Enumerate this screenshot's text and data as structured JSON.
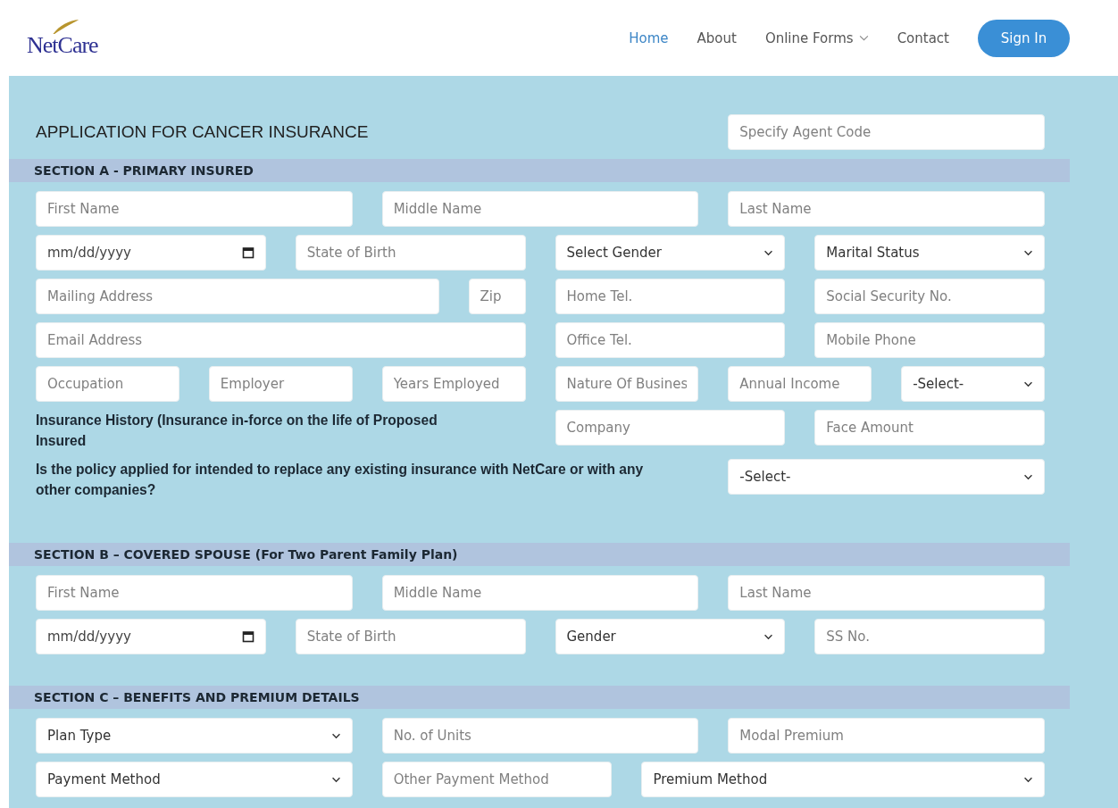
{
  "header": {
    "logo": "NetCare",
    "nav": [
      {
        "label": "Home",
        "selected": true,
        "has_menu": false
      },
      {
        "label": "About",
        "selected": false,
        "has_menu": false
      },
      {
        "label": "Online Forms",
        "selected": false,
        "has_menu": true
      },
      {
        "label": "Contact",
        "selected": false,
        "has_menu": false
      }
    ],
    "sign_in": "Sign In"
  },
  "form": {
    "title": "APPLICATION FOR CANCER INSURANCE",
    "agent_code": {
      "placeholder": "Specify Agent Code"
    },
    "sections": [
      {
        "title": "SECTION A - PRIMARY INSURED",
        "rows": [
          {
            "fields": [
              {
                "kind": "text",
                "placeholder": "First Name"
              },
              {
                "kind": "text",
                "placeholder": "Middle Name"
              },
              {
                "kind": "text",
                "placeholder": "Last Name"
              }
            ]
          },
          {
            "fields": [
              {
                "kind": "date",
                "placeholder": "mm/dd/yyyy"
              },
              {
                "kind": "text",
                "placeholder": "State of Birth"
              },
              {
                "kind": "select",
                "value": "Select Gender"
              },
              {
                "kind": "select",
                "value": "Marital Status"
              }
            ]
          },
          {
            "fields": [
              {
                "kind": "text",
                "placeholder": "Mailing Address"
              },
              {
                "kind": "text",
                "placeholder": "Zip"
              },
              {
                "kind": "text",
                "placeholder": "Home Tel."
              },
              {
                "kind": "text",
                "placeholder": "Social Security No."
              }
            ]
          },
          {
            "fields": [
              {
                "kind": "text",
                "placeholder": "Email Address"
              },
              {
                "kind": "text",
                "placeholder": "Office Tel."
              },
              {
                "kind": "text",
                "placeholder": "Mobile Phone"
              }
            ]
          },
          {
            "fields": [
              {
                "kind": "text",
                "placeholder": "Occupation"
              },
              {
                "kind": "text",
                "placeholder": "Employer"
              },
              {
                "kind": "text",
                "placeholder": "Years Employed"
              },
              {
                "kind": "text",
                "placeholder": "Nature Of Busines"
              },
              {
                "kind": "text",
                "placeholder": "Annual Income"
              },
              {
                "kind": "select",
                "value": "-Select-"
              }
            ]
          },
          {
            "fields": [
              {
                "kind": "label",
                "text": "Insurance History (Insurance in-force on the life of Proposed Insured"
              },
              {
                "kind": "text",
                "placeholder": "Company"
              },
              {
                "kind": "text",
                "placeholder": "Face Amount"
              }
            ]
          },
          {
            "fields": [
              {
                "kind": "label",
                "text": "Is the policy applied for intended to replace any existing insurance with NetCare or with any other companies?"
              },
              {
                "kind": "select",
                "value": "-Select-"
              }
            ]
          }
        ]
      },
      {
        "title": "SECTION B – COVERED SPOUSE (For Two Parent Family Plan)",
        "rows": [
          {
            "fields": [
              {
                "kind": "text",
                "placeholder": "First Name"
              },
              {
                "kind": "text",
                "placeholder": "Middle Name"
              },
              {
                "kind": "text",
                "placeholder": "Last Name"
              }
            ]
          },
          {
            "fields": [
              {
                "kind": "date",
                "placeholder": "mm/dd/yyyy"
              },
              {
                "kind": "text",
                "placeholder": "State of Birth"
              },
              {
                "kind": "select",
                "value": "Gender"
              },
              {
                "kind": "text",
                "placeholder": "SS No."
              }
            ]
          }
        ]
      },
      {
        "title": "SECTION C – BENEFITS AND PREMIUM DETAILS",
        "rows": [
          {
            "fields": [
              {
                "kind": "select",
                "value": "Plan Type"
              },
              {
                "kind": "text",
                "placeholder": "No. of Units"
              },
              {
                "kind": "text",
                "placeholder": "Modal Premium"
              }
            ]
          },
          {
            "fields": [
              {
                "kind": "select",
                "value": "Payment Method"
              },
              {
                "kind": "text",
                "placeholder": "Other Payment Method"
              },
              {
                "kind": "select",
                "value": "Premium Method"
              }
            ]
          }
        ]
      }
    ]
  }
}
